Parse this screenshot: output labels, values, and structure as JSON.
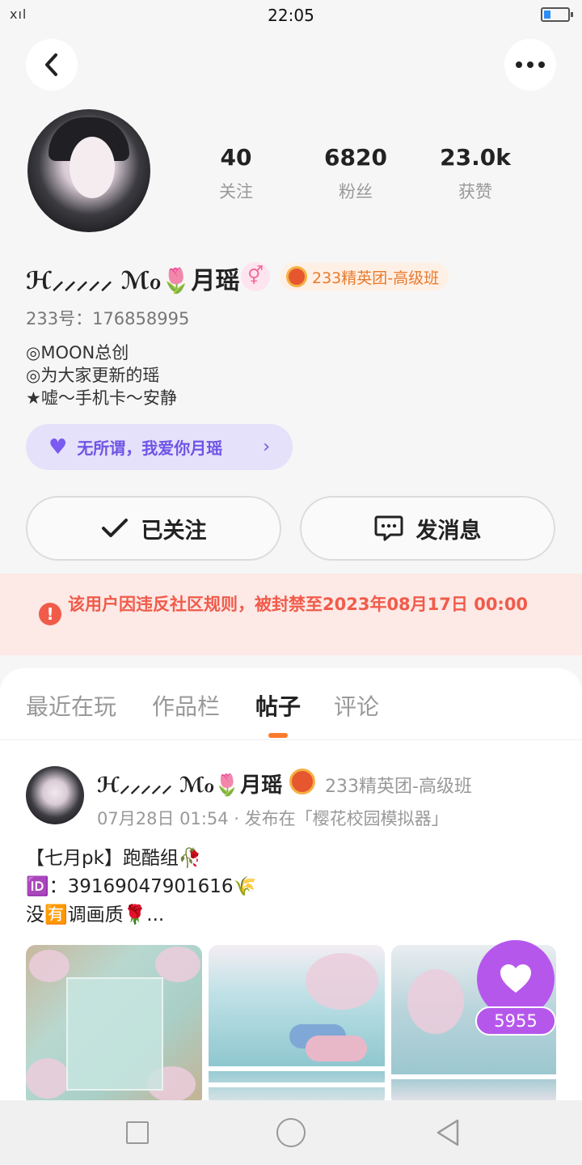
{
  "status_bar": {
    "signal": "ⅹıl",
    "time": "22:05"
  },
  "profile": {
    "stats": [
      {
        "value": "40",
        "label": "关注"
      },
      {
        "value": "6820",
        "label": "粉丝"
      },
      {
        "value": "23.0k",
        "label": "获赞"
      }
    ],
    "nickname": "ℋ⸝⸝⸝⸝⸝ ℳℴ🌷月瑶",
    "gender_symbol": "⚥",
    "rank_badge": "233精英团-高级班",
    "uid": "233号：176858995",
    "bio_lines": [
      "◎MOON总创",
      "◎为大家更新的瑶",
      "★嘘～手机卡～安静"
    ],
    "love_pill": "无所谓，我爱你月瑶",
    "follow_button": "已关注",
    "message_button": "发消息"
  },
  "ban_notice": "该用户因违反社区规则，被封禁至2023年08月17日 00:00",
  "tabs": [
    {
      "label": "最近在玩",
      "active": false
    },
    {
      "label": "作品栏",
      "active": false
    },
    {
      "label": "帖子",
      "active": true
    },
    {
      "label": "评论",
      "active": false
    }
  ],
  "post": {
    "author": "ℋ⸝⸝⸝⸝⸝ ℳℴ🌷月瑶",
    "rank": "233精英团-高级班",
    "meta": "07月28日 01:54 · 发布在「樱花校园模拟器」",
    "text_lines": [
      "【七月pk】跑酷组🥀",
      "🆔：39169047901616🌾",
      "没🈶调画质🌹..."
    ],
    "likes": "5955"
  },
  "colors": {
    "accent": "#ff7a2a",
    "like_purple": "#b657ec",
    "ban_red": "#f15b4a",
    "pill_purple": "#6f55e6"
  }
}
